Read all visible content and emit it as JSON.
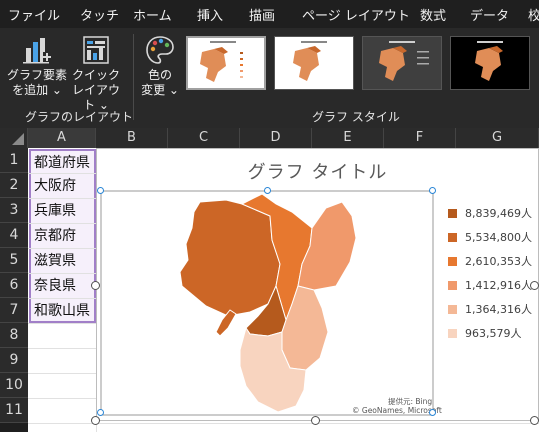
{
  "menu_tabs": [
    "ファイル",
    "タッチ",
    "ホーム",
    "挿入",
    "描画",
    "ページ レイアウト",
    "数式",
    "データ",
    "校"
  ],
  "ribbon": {
    "add_element": {
      "line1": "グラフ要素",
      "line2": "を追加 ⌄"
    },
    "quick_layout": {
      "line1": "クイック",
      "line2": "レイアウト ⌄"
    },
    "change_color": {
      "line1": "色の",
      "line2": "変更 ⌄"
    },
    "group_layout_label": "グラフのレイアウト",
    "group_style_label": "グラフ スタイル"
  },
  "columns": [
    "A",
    "B",
    "C",
    "D",
    "E",
    "F",
    "G"
  ],
  "rows": [
    "1",
    "2",
    "3",
    "4",
    "5",
    "6",
    "7",
    "8",
    "9",
    "10",
    "11"
  ],
  "cells_a": [
    "都道府県",
    "大阪府",
    "兵庫県",
    "京都府",
    "滋賀県",
    "奈良県",
    "和歌山県"
  ],
  "chart": {
    "title": "グラフ タイトル",
    "legend": [
      {
        "label": "8,839,469人",
        "color": "#b55a1d"
      },
      {
        "label": "5,534,800人",
        "color": "#cc6626"
      },
      {
        "label": "2,610,353人",
        "color": "#e7782f"
      },
      {
        "label": "1,412,916人",
        "color": "#f0996b"
      },
      {
        "label": "1,364,316人",
        "color": "#f4b896"
      },
      {
        "label": "963,579人",
        "color": "#f8d4bf"
      }
    ],
    "credit_provider": "提供元: Bing",
    "credit_copyright": "© GeoNames, Microsoft"
  },
  "colors": {
    "background": "#1f1f1f",
    "ribbon": "#292929",
    "selection": "#a17fc8"
  }
}
